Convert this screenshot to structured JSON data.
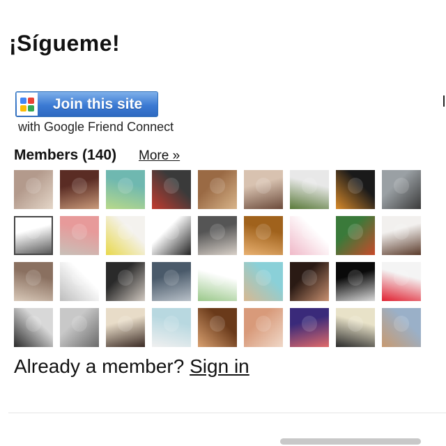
{
  "widget": {
    "title": "¡Sígueme!",
    "join_button_label": "Join this site",
    "join_subtitle": "with Google Friend Connect",
    "members_heading": "Members (140)",
    "more_link": "More »",
    "already_member_text": "Already a member?",
    "sign_in_link": "Sign in"
  },
  "colors": {
    "join_button_top": "#7fb0ea",
    "join_button_bottom": "#2e69c1",
    "google_logo": [
      "#4285f4",
      "#ea4335",
      "#fbbc05",
      "#34a853"
    ]
  },
  "avatars": [
    {
      "colors": [
        "#b39a8c",
        "#e4d6c8"
      ]
    },
    {
      "colors": [
        "#5a2c24",
        "#c99a7a"
      ]
    },
    {
      "colors": [
        "#6fb8b0",
        "#b8d98a"
      ]
    },
    {
      "colors": [
        "#3a3a3a",
        "#c23a2e"
      ]
    },
    {
      "colors": [
        "#9a6a44",
        "#d8b48a"
      ]
    },
    {
      "colors": [
        "#d8c2b0",
        "#6b4a3a"
      ]
    },
    {
      "colors": [
        "#e8e8e8",
        "#5a7a3a"
      ]
    },
    {
      "colors": [
        "#1a1a1a",
        "#d88a2a"
      ]
    },
    {
      "colors": [
        "#9aa0a4",
        "#3a3a3a"
      ]
    },
    {
      "colors": [
        "#ffffff",
        "#5a5a5a"
      ],
      "outline": true
    },
    {
      "colors": [
        "#e79a9a",
        "#c8c0b8"
      ]
    },
    {
      "colors": [
        "#f4f2ee",
        "#e8d84a"
      ]
    },
    {
      "colors": [
        "#ffffff",
        "#222222"
      ]
    },
    {
      "colors": [
        "#555555",
        "#d8d0c8"
      ]
    },
    {
      "colors": [
        "#a0621c",
        "#e8b070"
      ]
    },
    {
      "colors": [
        "#ffffff",
        "#f0b8c8"
      ]
    },
    {
      "colors": [
        "#3a7a3a",
        "#c84a2a"
      ]
    },
    {
      "colors": [
        "#f2f0ee",
        "#5a3a2a"
      ]
    },
    {
      "colors": [
        "#8a7060",
        "#d8c8b8"
      ]
    },
    {
      "colors": [
        "#ffffff",
        "#bdbdbd"
      ]
    },
    {
      "colors": [
        "#2a2a2a",
        "#d0c8c0"
      ]
    },
    {
      "colors": [
        "#4a5a6a",
        "#b8c0c8"
      ]
    },
    {
      "colors": [
        "#ffffff",
        "#9ac88a"
      ]
    },
    {
      "colors": [
        "#8ad0d8",
        "#d8b890"
      ]
    },
    {
      "colors": [
        "#2a1a14",
        "#c89070"
      ]
    },
    {
      "colors": [
        "#0a0a0a",
        "#d8d8d8"
      ]
    },
    {
      "colors": [
        "#f4f4f4",
        "#e02030"
      ]
    },
    {
      "colors": [
        "#d8d8d8",
        "#2a2a2a"
      ]
    },
    {
      "colors": [
        "#c8c8c8",
        "#6a6a6a"
      ]
    },
    {
      "colors": [
        "#e8dcc8",
        "#3a2a24"
      ]
    },
    {
      "colors": [
        "#b8d8e0",
        "#f0f0f0"
      ]
    },
    {
      "colors": [
        "#6a3a1a",
        "#d8a070"
      ]
    },
    {
      "colors": [
        "#d89a7a",
        "#f0d8c8"
      ]
    },
    {
      "colors": [
        "#3a2a7a",
        "#e06a6a"
      ]
    },
    {
      "colors": [
        "#e8e2c8",
        "#2a2a2a"
      ]
    },
    {
      "colors": [
        "#9ab0c8",
        "#c89a70"
      ]
    }
  ]
}
